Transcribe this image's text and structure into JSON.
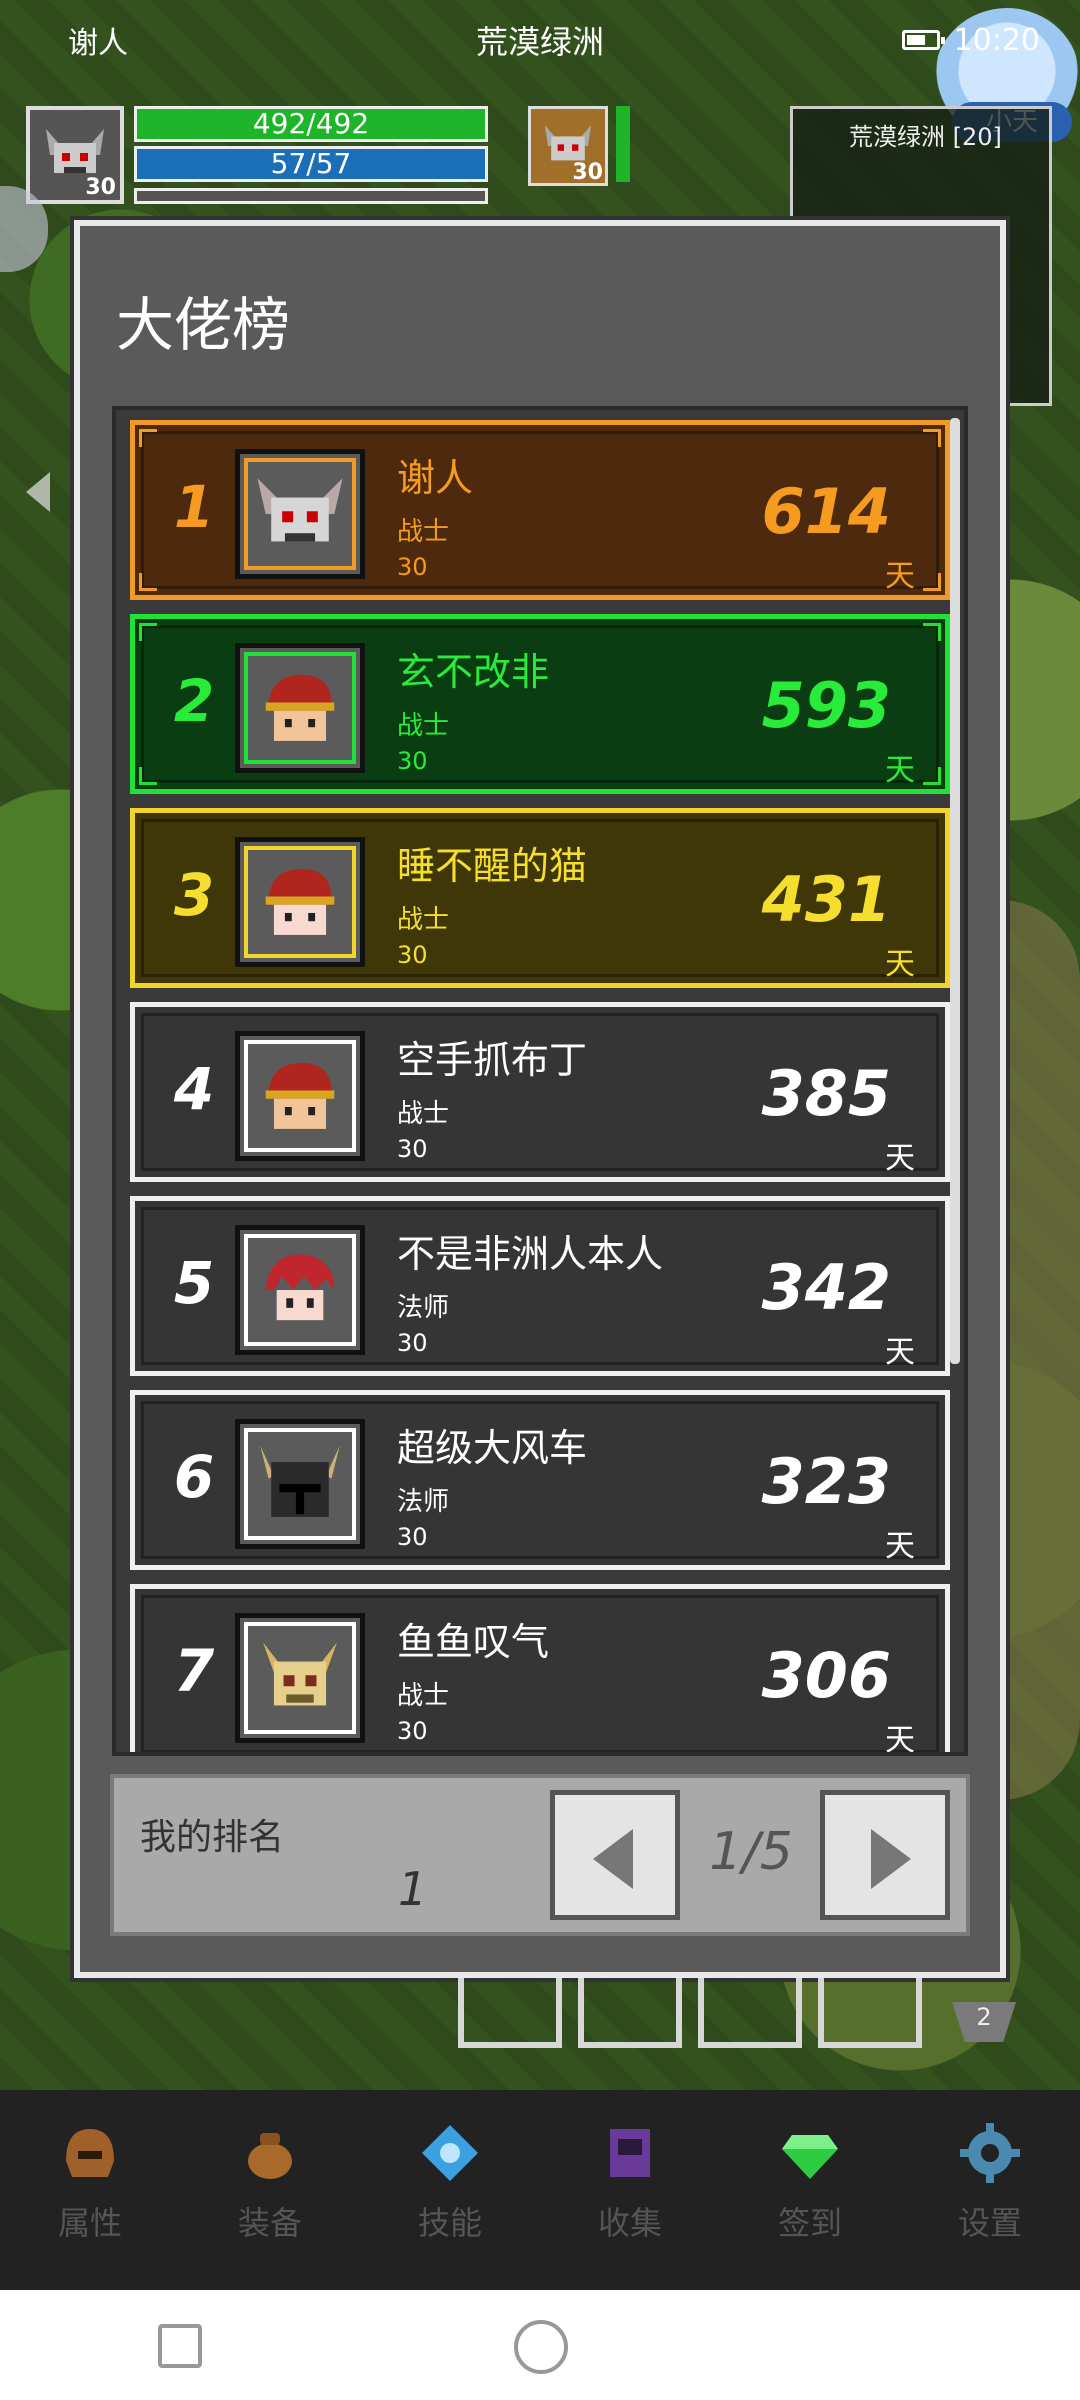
{
  "status_bar": {
    "player_name": "谢人",
    "zone": "荒漠绿洲",
    "time": "10:20"
  },
  "hud": {
    "player_level": "30",
    "hp": "492/492",
    "mp": "57/57",
    "pet_level": "30",
    "minimap_label": "荒漠绿洲 [20]",
    "assistant_label": "小天"
  },
  "modal": {
    "title": "大佬榜",
    "entries": [
      {
        "rank": "1",
        "name": "谢人",
        "class": "战士",
        "level": "30",
        "days": "614",
        "unit": "天",
        "style": "gold"
      },
      {
        "rank": "2",
        "name": "玄不改非",
        "class": "战士",
        "level": "30",
        "days": "593",
        "unit": "天",
        "style": "green"
      },
      {
        "rank": "3",
        "name": "睡不醒的猫",
        "class": "战士",
        "level": "30",
        "days": "431",
        "unit": "天",
        "style": "yellow"
      },
      {
        "rank": "4",
        "name": "空手抓布丁",
        "class": "战士",
        "level": "30",
        "days": "385",
        "unit": "天",
        "style": "plain"
      },
      {
        "rank": "5",
        "name": "不是非洲人本人",
        "class": "法师",
        "level": "30",
        "days": "342",
        "unit": "天",
        "style": "plain"
      },
      {
        "rank": "6",
        "name": "超级大风车",
        "class": "法师",
        "level": "30",
        "days": "323",
        "unit": "天",
        "style": "plain"
      },
      {
        "rank": "7",
        "name": "鱼鱼叹气",
        "class": "战士",
        "level": "30",
        "days": "306",
        "unit": "天",
        "style": "plain"
      }
    ],
    "my_rank_label": "我的排名",
    "my_rank_value": "1",
    "page": "1/5"
  },
  "quick_slot_badge": "2",
  "bottom_nav": [
    {
      "label": "属性",
      "icon": "helmet-icon",
      "color": "#a0602a"
    },
    {
      "label": "装备",
      "icon": "bag-icon",
      "color": "#a86a2a"
    },
    {
      "label": "技能",
      "icon": "skill-gem-icon",
      "color": "#3aa0e0"
    },
    {
      "label": "收集",
      "icon": "collection-book-icon",
      "color": "#6a3a9a"
    },
    {
      "label": "签到",
      "icon": "checkin-emerald-icon",
      "color": "#2ecc40"
    },
    {
      "label": "设置",
      "icon": "gear-icon",
      "color": "#4a8ab0"
    }
  ]
}
